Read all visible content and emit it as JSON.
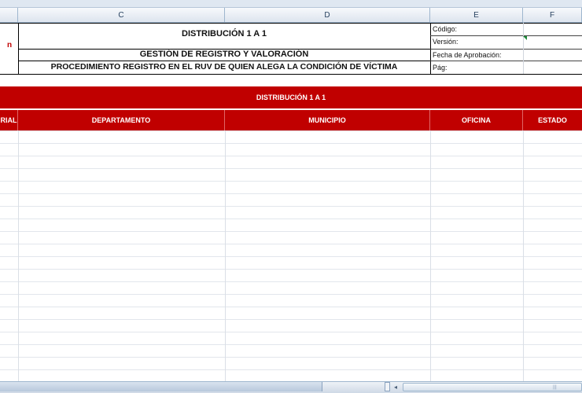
{
  "columns": {
    "c": "C",
    "d": "D",
    "e": "E",
    "f": "F"
  },
  "header": {
    "title": "DISTRIBUCIÓN 1 A 1",
    "subtitle": "GESTIÓN DE REGISTRO Y VALORACIÓN",
    "procedure": "PROCEDIMIENTO REGISTRO EN EL RUV DE QUIEN ALEGA LA CONDICIÓN DE VÍCTIMA",
    "logo_fragment": "n"
  },
  "meta": {
    "codigo": "Código:",
    "version": "Versión:",
    "fecha": "Fecha de Aprobación:",
    "pag": "Pág:"
  },
  "table": {
    "band_title": "DISTRIBUCIÓN 1 A 1",
    "headers": [
      "RIAL",
      "DEPARTAMENTO",
      "MUNICIPIO",
      "OFICINA",
      "ESTADO"
    ]
  },
  "colors": {
    "header_red": "#c00000"
  }
}
